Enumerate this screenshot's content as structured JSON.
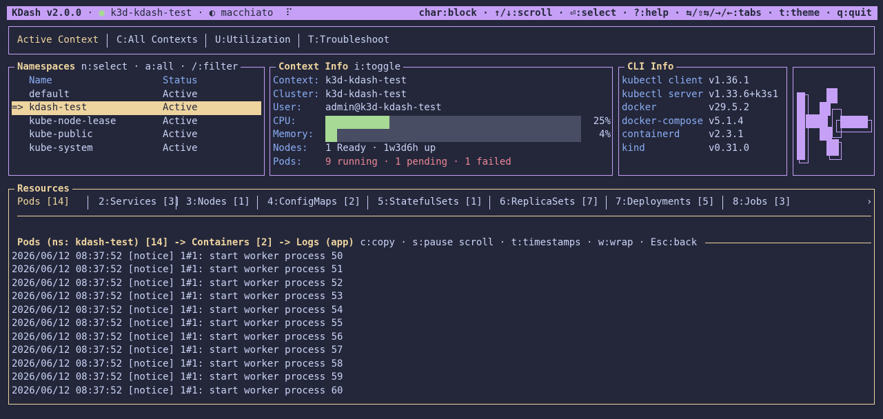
{
  "topbar": {
    "app": "KDash v2.0.0",
    "sep1": " · ",
    "dot": "●",
    "context": " k3d-kdash-test",
    "sep2": " · ",
    "theme_icon": "◐",
    "theme": " macchiato",
    "spinner": "⠏",
    "hints": "char:block · ↑/↓:scroll · ⏎:select · ?:help · ⇆/⇧⇆/→/←:tabs · t:theme · q:quit"
  },
  "main_tabs": [
    {
      "label": "Active Context",
      "active": true
    },
    {
      "label": "C:All Contexts"
    },
    {
      "label": "U:Utilization"
    },
    {
      "label": "T:Troubleshoot"
    }
  ],
  "namespaces": {
    "title": "Namespaces",
    "hints": "n:select · a:all · /:filter",
    "headers": {
      "name": "Name",
      "status": "Status"
    },
    "cursor": "=>",
    "rows": [
      {
        "name": "default",
        "status": "Active"
      },
      {
        "name": "kdash-test",
        "status": "Active",
        "selected": true
      },
      {
        "name": "kube-node-lease",
        "status": "Active"
      },
      {
        "name": "kube-public",
        "status": "Active"
      },
      {
        "name": "kube-system",
        "status": "Active"
      }
    ]
  },
  "context_info": {
    "title": "Context Info",
    "hints": "i:toggle",
    "context_label": "Context:",
    "context": "k3d-kdash-test",
    "cluster_label": "Cluster:",
    "cluster": "k3d-kdash-test",
    "user_label": "User:",
    "user": "admin@k3d-kdash-test",
    "cpu_label": "CPU:",
    "cpu_pct": "25%",
    "cpu_value": 0.25,
    "memory_label": "Memory:",
    "memory_pct": "4%",
    "memory_value": 0.04,
    "nodes_label": "Nodes:",
    "nodes": "1 Ready · 1w3d6h up",
    "pods_label": "Pods:",
    "pods": "9 running · 1 pending · 1 failed"
  },
  "cli_info": {
    "title": "CLI Info",
    "rows": [
      {
        "name": "kubectl client",
        "version": "v1.36.1"
      },
      {
        "name": "kubectl server",
        "version": "v1.33.6+k3s1"
      },
      {
        "name": "docker",
        "version": "v29.5.2"
      },
      {
        "name": "docker-compose",
        "version": "v5.1.4"
      },
      {
        "name": "containerd",
        "version": "v2.3.1"
      },
      {
        "name": "kind",
        "version": "v0.31.0"
      }
    ]
  },
  "resources": {
    "title": "Resources",
    "tabs": [
      {
        "label": "Pods [14]",
        "active": true
      },
      {
        "label": "2:Services [3]"
      },
      {
        "label": "3:Nodes [1]"
      },
      {
        "label": "4:ConfigMaps [2]"
      },
      {
        "label": "5:StatefulSets [1]"
      },
      {
        "label": "6:ReplicaSets [7]"
      },
      {
        "label": "7:Deployments [5]"
      },
      {
        "label": "8:Jobs [3]"
      }
    ],
    "more": "›",
    "logs_title": "Pods (ns: kdash-test) [14] -> Containers [2] -> Logs (app)",
    "logs_hints": "c:copy · s:pause scroll · t:timestamps · w:wrap · Esc:back",
    "log_lines": [
      "2026/06/12 08:37:52 [notice] 1#1: start worker process 50",
      "2026/06/12 08:37:52 [notice] 1#1: start worker process 51",
      "2026/06/12 08:37:52 [notice] 1#1: start worker process 52",
      "2026/06/12 08:37:52 [notice] 1#1: start worker process 53",
      "2026/06/12 08:37:52 [notice] 1#1: start worker process 54",
      "2026/06/12 08:37:52 [notice] 1#1: start worker process 55",
      "2026/06/12 08:37:52 [notice] 1#1: start worker process 56",
      "2026/06/12 08:37:52 [notice] 1#1: start worker process 57",
      "2026/06/12 08:37:52 [notice] 1#1: start worker process 58",
      "2026/06/12 08:37:52 [notice] 1#1: start worker process 59",
      "2026/06/12 08:37:52 [notice] 1#1: start worker process 60"
    ]
  },
  "colors": {
    "background": "#24273a",
    "accent": "#c6a0f6",
    "highlight": "#eed49f",
    "label": "#8aadf4",
    "gauge_fill": "#a6da95",
    "error": "#ed8796"
  }
}
